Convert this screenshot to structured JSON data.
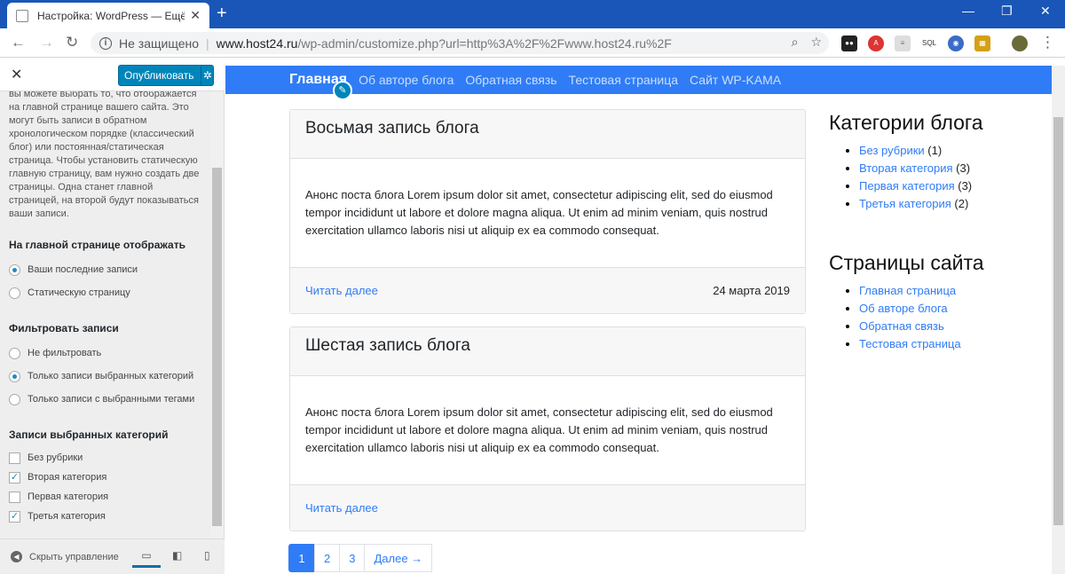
{
  "browser": {
    "tab_title": "Настройка: WordPress — Ещё о...",
    "security_label": "Не защищено",
    "url_host": "www.host24.ru",
    "url_path": "/wp-admin/customize.php?url=http%3A%2F%2Fwww.host24.ru%2F"
  },
  "customizer": {
    "publish_label": "Опубликовать",
    "description": "вы можете выбрать то, что отображается на главной странице вашего сайта. Это могут быть записи в обратном хронологическом порядке (классический блог) или постоянная/статическая страница. Чтобы установить статическую главную страницу, вам нужно создать две страницы. Одна станет главной страницей, на второй будут показываться ваши записи.",
    "homepage_section": "На главной странице отображать",
    "homepage_options": [
      "Ваши последние записи",
      "Статическую страницу"
    ],
    "homepage_selected": 0,
    "filter_section": "Фильтровать записи",
    "filter_options": [
      "Не фильтровать",
      "Только записи выбранных категорий",
      "Только записи с выбранными тегами"
    ],
    "filter_selected": 1,
    "categories_section": "Записи выбранных категорий",
    "categories": [
      {
        "label": "Без рубрики",
        "checked": false
      },
      {
        "label": "Вторая категория",
        "checked": true
      },
      {
        "label": "Первая категория",
        "checked": false
      },
      {
        "label": "Третья категория",
        "checked": true
      }
    ],
    "collapse_label": "Скрыть управление"
  },
  "site": {
    "nav": [
      "Главная",
      "Об авторе блога",
      "Обратная связь",
      "Тестовая страница",
      "Сайт WP-KAMA"
    ],
    "posts": [
      {
        "title": "Восьмая запись блога",
        "excerpt": "Анонс поста блога Lorem ipsum dolor sit amet, consectetur adipiscing elit, sed do eiusmod tempor incididunt ut labore et dolore magna aliqua. Ut enim ad minim veniam, quis nostrud exercitation ullamco laboris nisi ut aliquip ex ea commodo consequat.",
        "read_more": "Читать далее",
        "date": "24 марта 2019"
      },
      {
        "title": "Шестая запись блога",
        "excerpt": "Анонс поста блога Lorem ipsum dolor sit amet, consectetur adipiscing elit, sed do eiusmod tempor incididunt ut labore et dolore magna aliqua. Ut enim ad minim veniam, quis nostrud exercitation ullamco laboris nisi ut aliquip ex ea commodo consequat.",
        "read_more": "Читать далее",
        "date": ""
      }
    ],
    "sidebar": {
      "categories_title": "Категории блога",
      "categories": [
        {
          "name": "Без рубрики",
          "count": "(1)"
        },
        {
          "name": "Вторая категория",
          "count": "(3)"
        },
        {
          "name": "Первая категория",
          "count": "(3)"
        },
        {
          "name": "Третья категория",
          "count": "(2)"
        }
      ],
      "pages_title": "Страницы сайта",
      "pages": [
        "Главная страница",
        "Об авторе блога",
        "Обратная связь",
        "Тестовая страница"
      ]
    },
    "pagination": [
      "1",
      "2",
      "3",
      "Далее →"
    ]
  }
}
